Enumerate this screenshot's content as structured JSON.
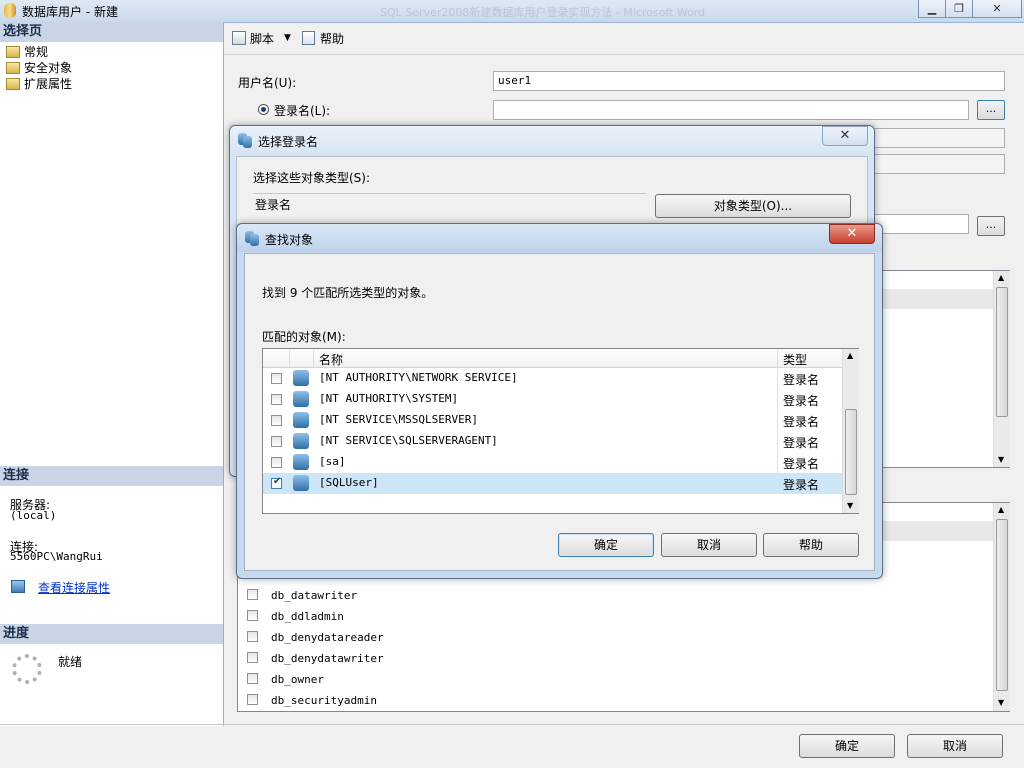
{
  "window": {
    "title": "数据库用户 - 新建",
    "ghost_title": "SQL Server2008新建数据库用户登录实现方法 - Microsoft Word"
  },
  "left": {
    "select_page_header": "选择页",
    "nav": [
      "常规",
      "安全对象",
      "扩展属性"
    ],
    "connection_header": "连接",
    "server_label": "服务器:",
    "server_value": "(local)",
    "connection_label": "连接:",
    "connection_value": "5560PC\\WangRui",
    "view_props_link": "查看连接属性",
    "progress_header": "进度",
    "progress_status": "就绪"
  },
  "toolbar": {
    "script": "脚本",
    "help": "帮助"
  },
  "form": {
    "username_label": "用户名(U):",
    "username_value": "user1",
    "login_radio": "登录名(L):",
    "browse": "..."
  },
  "roles": [
    "db_datawriter",
    "db_ddladmin",
    "db_denydatareader",
    "db_denydatawriter",
    "db_owner",
    "db_securityadmin"
  ],
  "bottom": {
    "ok": "确定",
    "cancel": "取消"
  },
  "select_login_dialog": {
    "title": "选择登录名",
    "object_types_label": "选择这些对象类型(S):",
    "object_types_value": "登录名",
    "object_types_button": "对象类型(O)..."
  },
  "find_dialog": {
    "title": "查找对象",
    "found_text": "找到 9 个匹配所选类型的对象。",
    "matched_label": "匹配的对象(M):",
    "col_name": "名称",
    "col_type": "类型",
    "rows": [
      {
        "name": "[NT AUTHORITY\\NETWORK SERVICE]",
        "type": "登录名",
        "checked": false
      },
      {
        "name": "[NT AUTHORITY\\SYSTEM]",
        "type": "登录名",
        "checked": false
      },
      {
        "name": "[NT SERVICE\\MSSQLSERVER]",
        "type": "登录名",
        "checked": false
      },
      {
        "name": "[NT SERVICE\\SQLSERVERAGENT]",
        "type": "登录名",
        "checked": false
      },
      {
        "name": "[sa]",
        "type": "登录名",
        "checked": false
      },
      {
        "name": "[SQLUser]",
        "type": "登录名",
        "checked": true
      }
    ],
    "ok": "确定",
    "cancel": "取消",
    "help": "帮助"
  },
  "colors": {
    "selection": "#cde6f7",
    "section_header": "#c9d5e6",
    "close_red": "#c7402e",
    "link": "#0033cc"
  }
}
